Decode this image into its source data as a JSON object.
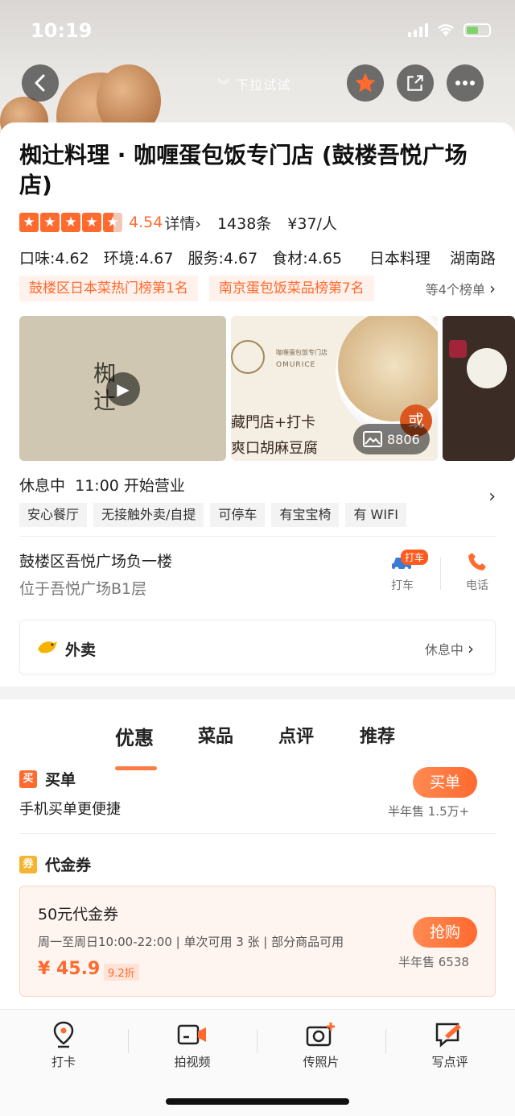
{
  "status": {
    "time": "10:19"
  },
  "header": {
    "pull_hint": "下拉试试"
  },
  "shop": {
    "title": "椥辻料理 · 咖喱蛋包饭专门店 (鼓楼吾悦广场店)",
    "rating_score": "4.54",
    "rating_value": 4.5,
    "details_label": "详情",
    "review_count": "1438条",
    "avg_price": "¥37/人",
    "scores": [
      "口味:4.62",
      "环境:4.67",
      "服务:4.67",
      "食材:4.65"
    ],
    "category": "日本料理",
    "area": "湖南路",
    "ranks": [
      "鼓楼区日本菜热门榜第1名",
      "南京蛋包饭菜品榜第7名"
    ],
    "rank_more": "等4个榜单"
  },
  "photos": {
    "photo1_logo": "椥\n辻",
    "photo2_small": "咖喱蛋包饭专门店",
    "photo2_brand": "OMURICE",
    "photo2_line1": "藏門店+打卡",
    "photo2_line2": "爽口胡麻豆腐",
    "photo2_badge": "或",
    "count": "8806"
  },
  "hours": {
    "status": "休息中",
    "open_text": "11:00 开始营业"
  },
  "facility_tags": [
    "安心餐厅",
    "无接触外卖/自提",
    "可停车",
    "有宝宝椅",
    "有 WIFI"
  ],
  "address": {
    "line1": "鼓楼区吾悦广场负一楼",
    "line2": "位于吾悦广场B1层",
    "taxi_badge": "打车",
    "taxi_label": "打车",
    "phone_label": "电话"
  },
  "waimai": {
    "title": "外卖",
    "status": "休息中"
  },
  "tabs": [
    "优惠",
    "菜品",
    "点评",
    "推荐"
  ],
  "maidan": {
    "icon_text": "买",
    "title": "买单",
    "subtitle": "手机买单更便捷",
    "button": "买单",
    "sales": "半年售 1.5万+"
  },
  "voucher": {
    "icon_text": "券",
    "title": "代金券",
    "coupon_title": "50元代金券",
    "coupon_desc": "周一至周日10:00-22:00 | 单次可用 3 张 | 部分商品可用",
    "price": "¥ 45.9",
    "discount": "9.2折",
    "button": "抢购",
    "sales": "半年售 6538"
  },
  "bottom_bar": [
    "打卡",
    "拍视频",
    "传照片",
    "写点评"
  ],
  "colors": {
    "accent": "#ff6a2f",
    "text": "#222222"
  }
}
